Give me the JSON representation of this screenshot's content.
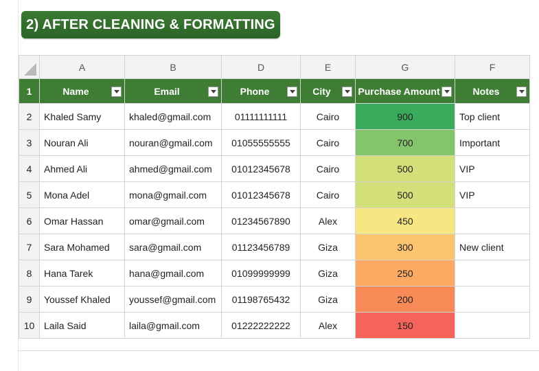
{
  "title": "2) AFTER CLEANING & FORMATTING",
  "column_letters": [
    "A",
    "B",
    "D",
    "E",
    "G",
    "F"
  ],
  "headers": [
    "Name",
    "Email",
    "Phone",
    "City",
    "Purchase Amount",
    "Notes"
  ],
  "header_color": "#3f7d34",
  "rows": [
    {
      "num": "1"
    },
    {
      "num": "2",
      "name": "Khaled Samy",
      "email": "khaled@gmail.com",
      "phone": "01111111111",
      "city": "Cairo",
      "amount": "900",
      "amount_color": "#3aaa5c",
      "notes": "Top client"
    },
    {
      "num": "3",
      "name": "Nouran Ali",
      "email": "nouran@gmail.com",
      "phone": "01055555555",
      "city": "Cairo",
      "amount": "700",
      "amount_color": "#84c46a",
      "notes": "Important"
    },
    {
      "num": "4",
      "name": "Ahmed Ali",
      "email": "ahmed@gmail.com",
      "phone": "01012345678",
      "city": "Cairo",
      "amount": "500",
      "amount_color": "#d3e07a",
      "notes": "VIP"
    },
    {
      "num": "5",
      "name": "Mona Adel",
      "email": "mona@gmail.com",
      "phone": "01012345678",
      "city": "Cairo",
      "amount": "500",
      "amount_color": "#d3e07a",
      "notes": "VIP"
    },
    {
      "num": "6",
      "name": "Omar Hassan",
      "email": "omar@gmail.com",
      "phone": "01234567890",
      "city": "Alex",
      "amount": "450",
      "amount_color": "#f8e683",
      "notes": ""
    },
    {
      "num": "7",
      "name": "Sara Mohamed",
      "email": "sara@gmail.com",
      "phone": "01123456789",
      "city": "Giza",
      "amount": "300",
      "amount_color": "#fcc46f",
      "notes": "New client"
    },
    {
      "num": "8",
      "name": "Hana Tarek",
      "email": "hana@gmail.com",
      "phone": "01099999999",
      "city": "Giza",
      "amount": "250",
      "amount_color": "#fcaa63",
      "notes": ""
    },
    {
      "num": "9",
      "name": "Youssef Khaled",
      "email": "youssef@gmail.com",
      "phone": "01198765432",
      "city": "Giza",
      "amount": "200",
      "amount_color": "#f88a58",
      "notes": ""
    },
    {
      "num": "10",
      "name": "Laila Said",
      "email": "laila@gmail.com",
      "phone": "01222222222",
      "city": "Alex",
      "amount": "150",
      "amount_color": "#f4645a",
      "notes": ""
    }
  ]
}
